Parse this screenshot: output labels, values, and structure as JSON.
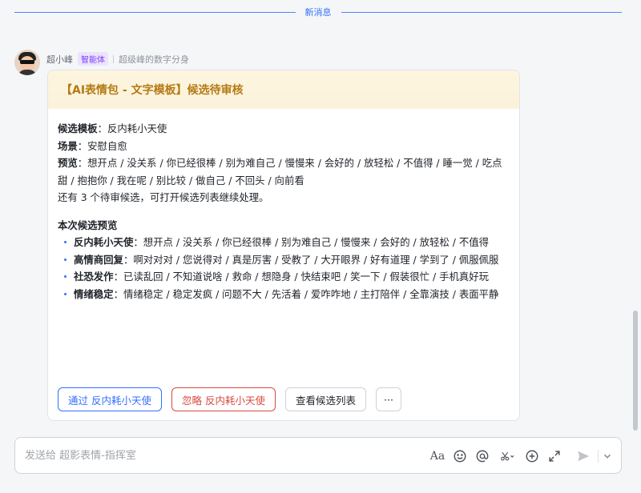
{
  "divider": {
    "label": "新消息"
  },
  "message": {
    "sender": "超小峰",
    "badge": "智能体",
    "subtitle": "超级峰的数字分身"
  },
  "card": {
    "title": "【AI表情包 - 文字模板】候选待审核",
    "fields": [
      {
        "label": "候选模板",
        "value": "：反内耗小天使"
      },
      {
        "label": "场景",
        "value": "：安慰自愈"
      },
      {
        "label": "预览",
        "value": "：想开点 / 没关系 / 你已经很棒 / 别为难自己 / 慢慢来 / 会好的 / 放轻松 / 不值得 / 睡一觉 / 吃点甜 / 抱抱你 / 我在呢 / 别比较 / 做自己 / 不回头 / 向前看"
      }
    ],
    "remaining_note": "还有 3 个待审候选，可打开候选列表继续处理。",
    "section_title": "本次候选预览",
    "previews": [
      {
        "name": "反内耗小天使",
        "text": "：想开点 / 没关系 / 你已经很棒 / 别为难自己 / 慢慢来 / 会好的 / 放轻松 / 不值得"
      },
      {
        "name": "高情商回复",
        "text": "：啊对对对 / 您说得对 / 真是厉害 / 受教了 / 大开眼界 / 好有道理 / 学到了 / 佩服佩服"
      },
      {
        "name": "社恐发作",
        "text": "：已读乱回 / 不知道说啥 / 救命 / 想隐身 / 快结束吧 / 笑一下 / 假装很忙 / 手机真好玩"
      },
      {
        "name": "情绪稳定",
        "text": "：情绪稳定 / 稳定发疯 / 问题不大 / 先活着 / 爱咋咋地 / 主打陪伴 / 全靠演技 / 表面平静"
      }
    ],
    "actions": {
      "approve": "通过 反内耗小天使",
      "ignore": "忽略 反内耗小天使",
      "view_list": "查看候选列表",
      "more": "···"
    }
  },
  "composer": {
    "placeholder": "发送给 超影表情-指挥室",
    "format_label": "Aa"
  }
}
